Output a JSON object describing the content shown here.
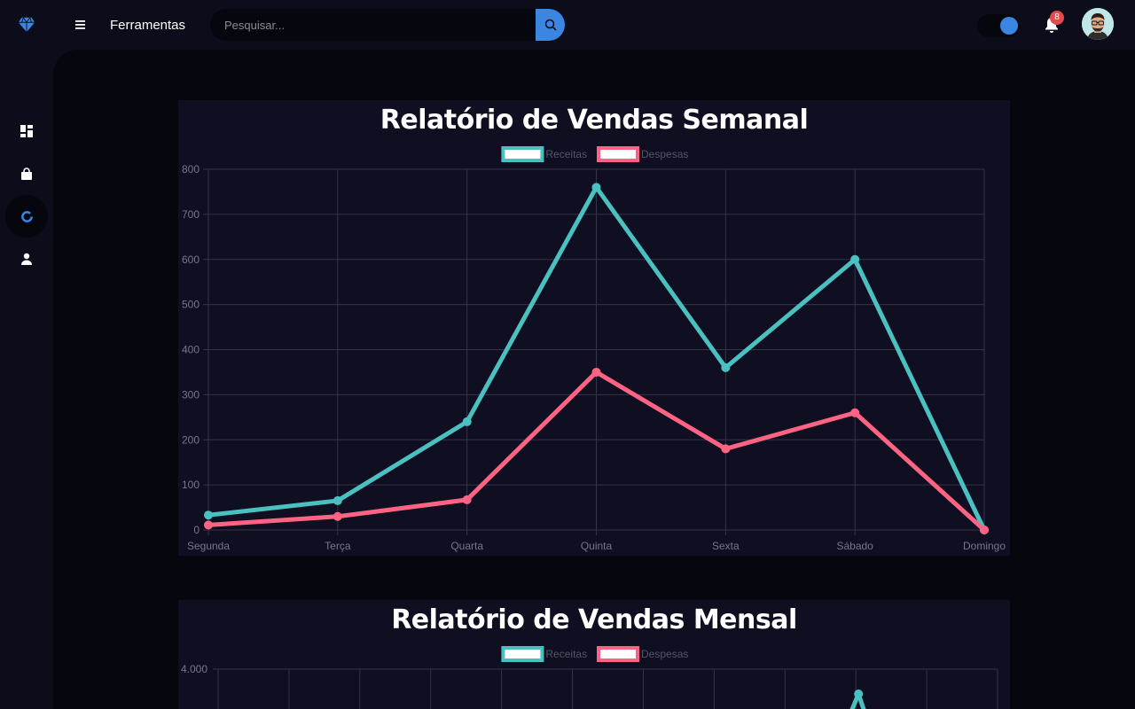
{
  "header": {
    "brand": "Ferramentas",
    "search_placeholder": "Pesquisar...",
    "notification_count": "8",
    "accent_color": "#3a86e0"
  },
  "sidebar": {
    "items": [
      {
        "icon": "dashboard-icon",
        "active": false
      },
      {
        "icon": "shopping-bag-icon",
        "active": false
      },
      {
        "icon": "donut-chart-icon",
        "active": true
      },
      {
        "icon": "user-icon",
        "active": false
      }
    ]
  },
  "chart_data": [
    {
      "type": "line",
      "title": "Relatório de Vendas Semanal",
      "categories": [
        "Segunda",
        "Terça",
        "Quarta",
        "Quinta",
        "Sexta",
        "Sábado",
        "Domingo"
      ],
      "series": [
        {
          "name": "Receitas",
          "color": "#4bc0c0",
          "values": [
            33,
            65,
            240,
            760,
            360,
            600,
            0
          ]
        },
        {
          "name": "Despesas",
          "color": "#ff6384",
          "values": [
            11,
            30,
            67,
            350,
            180,
            260,
            0
          ]
        }
      ],
      "ylim": [
        0,
        800
      ],
      "yticks": [
        "800",
        "700",
        "600",
        "500",
        "400",
        "300",
        "200",
        "100",
        "0"
      ],
      "grid": true,
      "legend": "top-center"
    },
    {
      "type": "line",
      "title": "Relatório de Vendas Mensal",
      "series": [
        {
          "name": "Receitas",
          "color": "#4bc0c0"
        },
        {
          "name": "Despesas",
          "color": "#ff6384"
        }
      ],
      "yticks": [
        "4.000"
      ],
      "grid": true,
      "legend": "top-center"
    }
  ]
}
